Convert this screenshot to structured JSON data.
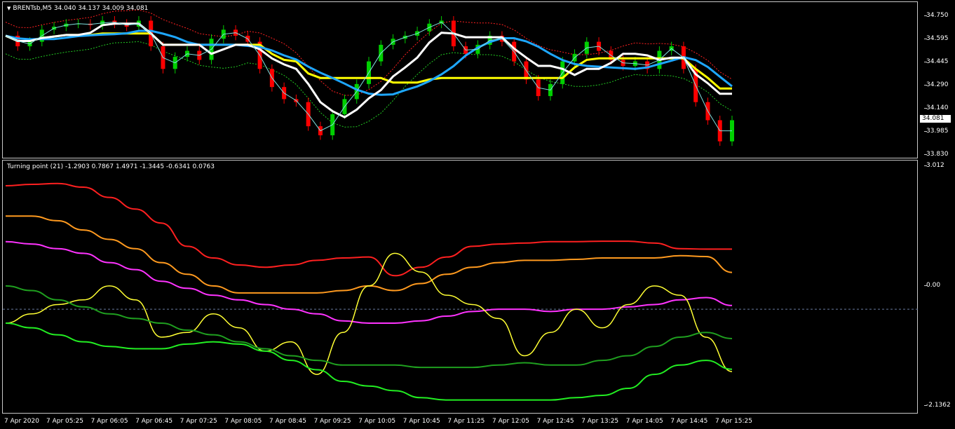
{
  "main_chart": {
    "title": "BRENTsb,M5  34.040 34.137 34.009 34.081",
    "current_price": "34.081",
    "y_ticks": [
      "34.750",
      "34.595",
      "34.445",
      "34.290",
      "34.140",
      "33.985",
      "33.830"
    ],
    "colors": {
      "bull": "#00d000",
      "bear": "#ff0000",
      "ma_yellow": "#ffff00",
      "ma_white": "#ffffff",
      "ma_blue": "#1ea7ff",
      "band_red": "#ff2020",
      "band_green": "#22cc22"
    }
  },
  "indicator": {
    "title": "Turning point (21) -1.2903 0.7867 1.4971 -1.3445 -0.6341 0.0763",
    "y_ticks": [
      "3.012",
      "0.00",
      "-2.1362"
    ],
    "colors": [
      "#ff2020",
      "#ff9a1f",
      "#ff33ff",
      "#ffff33",
      "#1f9f1f",
      "#22ee22"
    ]
  },
  "x_ticks": [
    "7 Apr 2020",
    "7 Apr 05:25",
    "7 Apr 06:05",
    "7 Apr 06:45",
    "7 Apr 07:25",
    "7 Apr 08:05",
    "7 Apr 08:45",
    "7 Apr 09:25",
    "7 Apr 10:05",
    "7 Apr 10:45",
    "7 Apr 11:25",
    "7 Apr 12:05",
    "7 Apr 12:45",
    "7 Apr 13:25",
    "7 Apr 14:05",
    "7 Apr 14:45",
    "7 Apr 15:25"
  ],
  "chart_data": [
    {
      "type": "candlestick",
      "title": "BRENTsb,M5  34.040 34.137 34.009 34.081",
      "ylim": [
        33.83,
        34.75
      ],
      "series": [
        {
          "name": "",
          "values": [
            34.62,
            34.55,
            34.58,
            34.66,
            34.68,
            34.7,
            34.7,
            34.69,
            34.72,
            34.7,
            34.68,
            34.72,
            34.55,
            34.4,
            34.48,
            34.52,
            34.46,
            34.6,
            34.66,
            34.62,
            34.58,
            34.4,
            34.28,
            34.2,
            34.18,
            34.02,
            33.96,
            34.1,
            34.2,
            34.3,
            34.45,
            34.56,
            34.6,
            34.62,
            34.65,
            34.7,
            34.72,
            34.55,
            34.5,
            34.56,
            34.62,
            34.58,
            34.45,
            34.33,
            34.22,
            34.3,
            34.45,
            34.5,
            34.58,
            34.52,
            34.46,
            34.42,
            34.45,
            34.4,
            34.52,
            34.55,
            34.4,
            34.18,
            34.06,
            33.92,
            34.06
          ]
        }
      ]
    },
    {
      "type": "line",
      "title": "Turning point (21) -1.2903 0.7867 1.4971 -1.3445 -0.6341 0.0763",
      "ylim": [
        -2.1362,
        3.012
      ],
      "series": [
        {
          "name": "",
          "values": [
            2.65,
            2.68,
            2.7,
            2.62,
            2.4,
            2.15,
            1.85,
            1.35,
            1.1,
            0.95,
            0.9,
            0.95,
            1.05,
            1.1,
            1.12,
            0.72,
            0.9,
            1.12,
            1.35,
            1.4,
            1.42,
            1.45,
            1.45,
            1.46,
            1.46,
            1.42,
            1.3,
            1.29,
            1.29
          ]
        },
        {
          "name": "",
          "values": [
            2.0,
            2.0,
            1.9,
            1.7,
            1.5,
            1.3,
            1.0,
            0.75,
            0.5,
            0.35,
            0.35,
            0.35,
            0.35,
            0.4,
            0.5,
            0.4,
            0.55,
            0.75,
            0.9,
            1.0,
            1.05,
            1.05,
            1.07,
            1.1,
            1.1,
            1.1,
            1.15,
            1.13,
            0.79
          ]
        },
        {
          "name": "",
          "values": [
            1.45,
            1.4,
            1.3,
            1.2,
            1.0,
            0.85,
            0.6,
            0.45,
            0.3,
            0.2,
            0.1,
            0.0,
            -0.1,
            -0.25,
            -0.3,
            -0.3,
            -0.25,
            -0.15,
            -0.05,
            0.0,
            0.0,
            -0.05,
            0.0,
            0.0,
            0.05,
            0.1,
            0.2,
            0.25,
            0.08
          ]
        },
        {
          "name": "",
          "values": [
            -0.3,
            -0.1,
            0.1,
            0.2,
            0.5,
            0.2,
            -0.6,
            -0.5,
            -0.1,
            -0.4,
            -0.9,
            -0.7,
            -1.4,
            -0.5,
            0.5,
            1.2,
            0.8,
            0.3,
            0.1,
            -0.2,
            -1.0,
            -0.5,
            0.0,
            -0.4,
            0.1,
            0.5,
            0.3,
            -0.6,
            -1.34
          ]
        },
        {
          "name": "",
          "values": [
            0.5,
            0.4,
            0.2,
            0.05,
            -0.1,
            -0.2,
            -0.3,
            -0.45,
            -0.55,
            -0.7,
            -0.85,
            -1.0,
            -1.1,
            -1.2,
            -1.2,
            -1.2,
            -1.25,
            -1.25,
            -1.25,
            -1.2,
            -1.15,
            -1.2,
            -1.2,
            -1.1,
            -1.0,
            -0.8,
            -0.6,
            -0.5,
            -0.63
          ]
        },
        {
          "name": "",
          "values": [
            -0.3,
            -0.4,
            -0.55,
            -0.7,
            -0.8,
            -0.85,
            -0.85,
            -0.75,
            -0.7,
            -0.75,
            -0.9,
            -1.1,
            -1.3,
            -1.55,
            -1.65,
            -1.75,
            -1.9,
            -1.95,
            -1.95,
            -1.95,
            -1.95,
            -1.95,
            -1.9,
            -1.85,
            -1.7,
            -1.4,
            -1.2,
            -1.1,
            -1.29
          ]
        }
      ]
    }
  ]
}
